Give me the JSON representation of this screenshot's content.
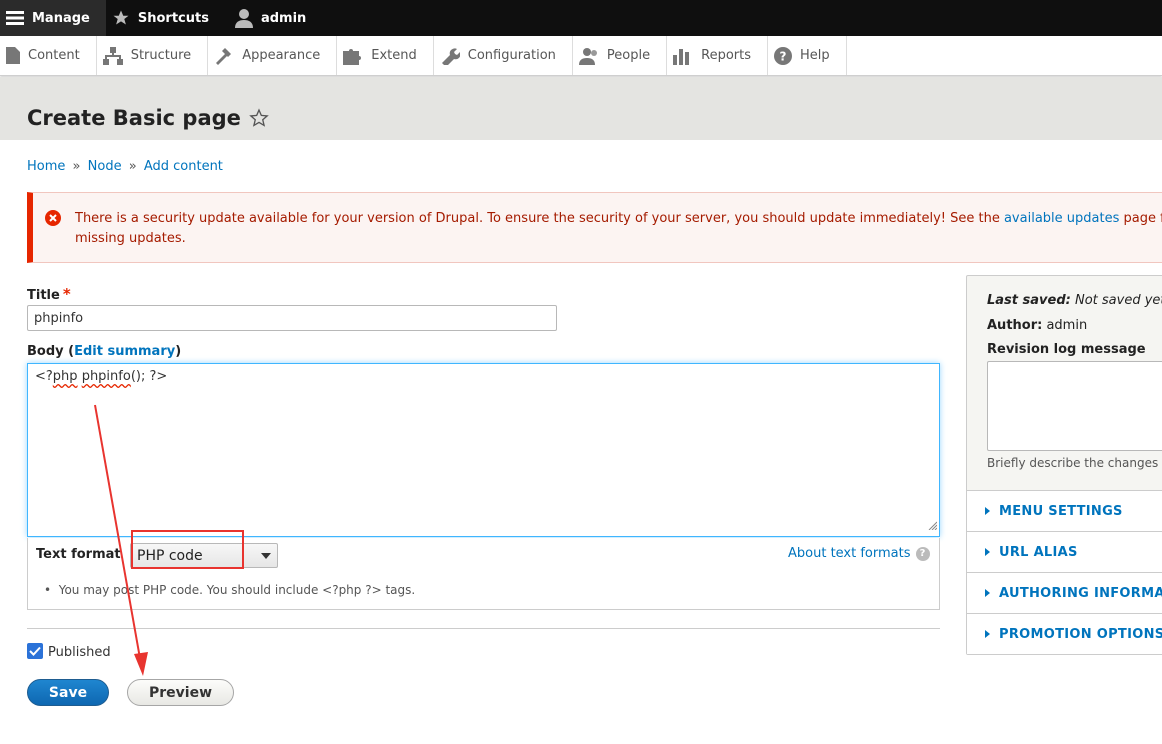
{
  "toolbar": {
    "manage": "Manage",
    "shortcuts": "Shortcuts",
    "user": "admin"
  },
  "tray": {
    "items": [
      {
        "label": "Content",
        "icon": "content-icon"
      },
      {
        "label": "Structure",
        "icon": "structure-icon"
      },
      {
        "label": "Appearance",
        "icon": "appearance-icon"
      },
      {
        "label": "Extend",
        "icon": "extend-icon"
      },
      {
        "label": "Configuration",
        "icon": "configuration-icon"
      },
      {
        "label": "People",
        "icon": "people-icon"
      },
      {
        "label": "Reports",
        "icon": "reports-icon"
      },
      {
        "label": "Help",
        "icon": "help-icon"
      }
    ]
  },
  "page": {
    "title": "Create Basic page"
  },
  "breadcrumb": {
    "items": [
      "Home",
      "Node",
      "Add content"
    ],
    "separator": "»"
  },
  "alert": {
    "text_before": "There is a security update available for your version of Drupal. To ensure the security of your server, you should update immediately! See the ",
    "link": "available updates",
    "text_after": " page fo",
    "line2": "missing updates.",
    "color": "#e62600"
  },
  "form": {
    "title_label": "Title",
    "required_mark": "*",
    "title_value": "phpinfo",
    "body_label": "Body",
    "edit_summary": "Edit summary",
    "body_code_prefix": "<?",
    "body_code_php": "php",
    "body_code_space": " ",
    "body_code_fn": "phpinfo",
    "body_code_suffix": "(); ?>",
    "text_format_label": "Text format",
    "text_format_value": "PHP code",
    "about_text_formats": "About text formats",
    "help_mark": "?",
    "format_tip": "You may post PHP code. You should include <?php ?> tags.",
    "published_label": "Published",
    "published": true,
    "save": "Save",
    "preview": "Preview"
  },
  "sidebar": {
    "last_saved_label": "Last saved:",
    "last_saved_value": "Not saved yet",
    "author_label": "Author:",
    "author_value": "admin",
    "revision_label": "Revision log message",
    "revision_hint": "Briefly describe the changes",
    "sections": [
      "MENU SETTINGS",
      "URL ALIAS",
      "AUTHORING INFORMATION",
      "PROMOTION OPTIONS"
    ]
  },
  "annotation": {
    "highlight_color": "#e8342f"
  }
}
